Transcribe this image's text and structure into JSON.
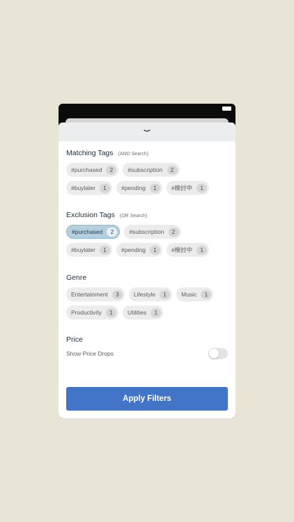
{
  "sections": {
    "matching": {
      "title": "Matching Tags",
      "subtitle": "(AND Search)",
      "chips": [
        {
          "label": "#purchased",
          "count": "2"
        },
        {
          "label": "#subscription",
          "count": "2"
        },
        {
          "label": "#buylater",
          "count": "1"
        },
        {
          "label": "#pending",
          "count": "1"
        },
        {
          "label": "#検討中",
          "count": "1"
        }
      ]
    },
    "exclusion": {
      "title": "Exclusion Tags",
      "subtitle": "(OR Search)",
      "chips": [
        {
          "label": "#purchased",
          "count": "2",
          "selected": true
        },
        {
          "label": "#subscription",
          "count": "2"
        },
        {
          "label": "#buylater",
          "count": "1"
        },
        {
          "label": "#pending",
          "count": "1"
        },
        {
          "label": "#検討中",
          "count": "1"
        }
      ]
    },
    "genre": {
      "title": "Genre",
      "chips": [
        {
          "label": "Entertainment",
          "count": "3"
        },
        {
          "label": "Lifestyle",
          "count": "1"
        },
        {
          "label": "Music",
          "count": "1"
        },
        {
          "label": "Productivity",
          "count": "1"
        },
        {
          "label": "Utilities",
          "count": "1"
        }
      ]
    },
    "price": {
      "title": "Price",
      "toggle_label": "Show Price Drops",
      "toggle_on": false
    }
  },
  "apply_label": "Apply Filters",
  "colors": {
    "background": "#e8e4d6",
    "accent": "#4275c8",
    "selected_chip": "#b4d0df"
  }
}
